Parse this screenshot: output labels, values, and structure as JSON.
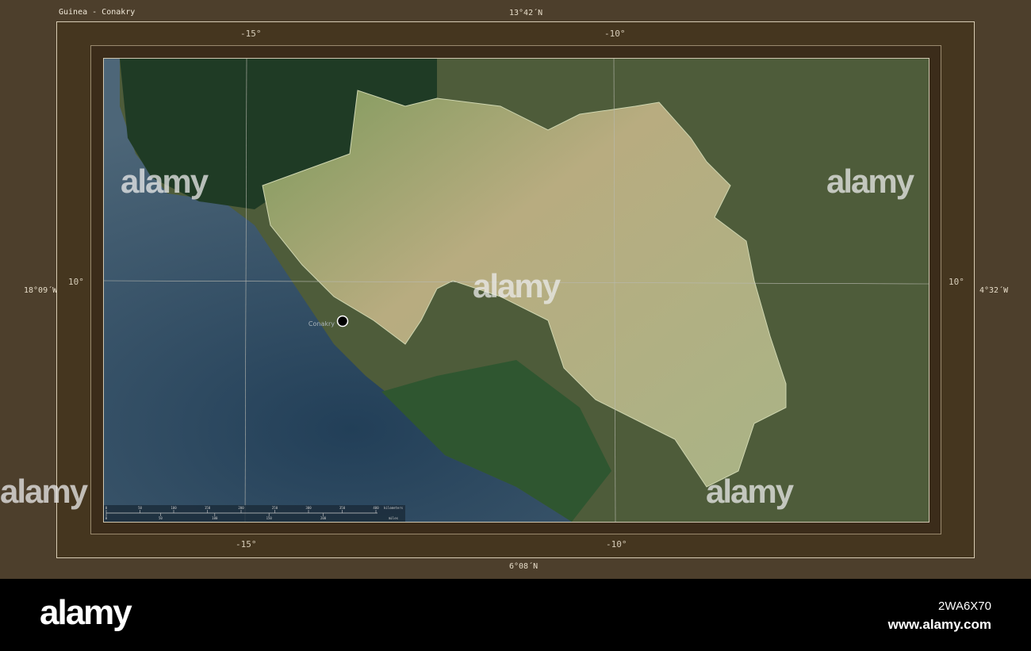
{
  "title": "Guinea - Conakry",
  "coords": {
    "top": "13°42´N",
    "bottom": "6°08´N",
    "left": "18°09´W",
    "right": "4°32´W"
  },
  "graticule": {
    "lon_a": "-15°",
    "lon_b": "-10°",
    "lat": "10°"
  },
  "marker": {
    "city": "Conakry"
  },
  "scale": {
    "km_ticks": [
      "0",
      "50",
      "100",
      "150",
      "200",
      "250",
      "300",
      "350",
      "400"
    ],
    "km_unit": "kilometers",
    "mi_ticks": [
      "0",
      "50",
      "100",
      "150",
      "200"
    ],
    "mi_unit": "miles"
  },
  "watermark": {
    "text": "alamy"
  },
  "footer": {
    "logo": "alamy",
    "image_id": "2WA6X70",
    "url": "www.alamy.com"
  },
  "colors": {
    "frame": "#4d3f2c",
    "ocean": "#3d5a70",
    "guinea": "#b5b58a",
    "neighbors": "#4b5a38"
  }
}
